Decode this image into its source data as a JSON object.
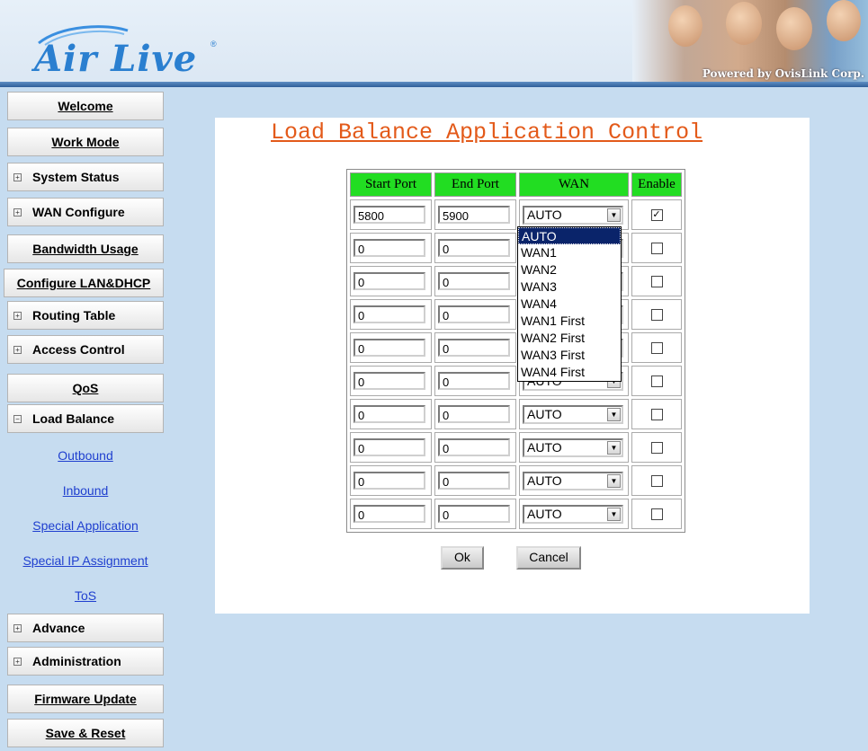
{
  "brand": {
    "name": "Air Live",
    "tagline": "Powered by OvisLink Corp."
  },
  "sidebar": {
    "items": [
      {
        "label": "Welcome",
        "type": "button"
      },
      {
        "label": "Work Mode",
        "type": "button"
      },
      {
        "label": "System Status",
        "type": "expand",
        "sign": "+"
      },
      {
        "label": "WAN Configure",
        "type": "expand",
        "sign": "+"
      },
      {
        "label": "Bandwidth Usage",
        "type": "button"
      },
      {
        "label": "Configure LAN&DHCP",
        "type": "button"
      },
      {
        "label": "Routing Table",
        "type": "expand",
        "sign": "+"
      },
      {
        "label": "Access Control",
        "type": "expand",
        "sign": "+"
      },
      {
        "label": "QoS",
        "type": "button"
      },
      {
        "label": "Load Balance",
        "type": "expand",
        "sign": "−"
      },
      {
        "label": "Advance",
        "type": "expand",
        "sign": "+"
      },
      {
        "label": "Administration",
        "type": "expand",
        "sign": "+"
      },
      {
        "label": "Firmware Update",
        "type": "button"
      },
      {
        "label": "Save & Reset",
        "type": "button"
      }
    ],
    "sublinks": [
      "Outbound",
      "Inbound",
      "Special Application",
      "Special IP Assignment",
      "ToS"
    ]
  },
  "main": {
    "title": "Load Balance Application Control",
    "columns": [
      "Start Port",
      "End Port",
      "WAN",
      "Enable"
    ],
    "rows": [
      {
        "start": "5800",
        "end": "5900",
        "wan": "AUTO",
        "enabled": true
      },
      {
        "start": "0",
        "end": "0",
        "wan": "AUTO",
        "enabled": false
      },
      {
        "start": "0",
        "end": "0",
        "wan": "AUTO",
        "enabled": false
      },
      {
        "start": "0",
        "end": "0",
        "wan": "AUTO",
        "enabled": false
      },
      {
        "start": "0",
        "end": "0",
        "wan": "AUTO",
        "enabled": false
      },
      {
        "start": "0",
        "end": "0",
        "wan": "AUTO",
        "enabled": false
      },
      {
        "start": "0",
        "end": "0",
        "wan": "AUTO",
        "enabled": false
      },
      {
        "start": "0",
        "end": "0",
        "wan": "AUTO",
        "enabled": false
      },
      {
        "start": "0",
        "end": "0",
        "wan": "AUTO",
        "enabled": false
      },
      {
        "start": "0",
        "end": "0",
        "wan": "AUTO",
        "enabled": false
      }
    ],
    "dropdown_options": [
      "AUTO",
      "WAN1",
      "WAN2",
      "WAN3",
      "WAN4",
      "WAN1 First",
      "WAN2 First",
      "WAN3 First",
      "WAN4 First"
    ],
    "dropdown_selected": "AUTO",
    "ok_label": "Ok",
    "cancel_label": "Cancel"
  },
  "colors": {
    "accent_title": "#e35a1a",
    "header_green": "#22dd22",
    "link": "#1f3fcf",
    "selection": "#0a246a"
  }
}
